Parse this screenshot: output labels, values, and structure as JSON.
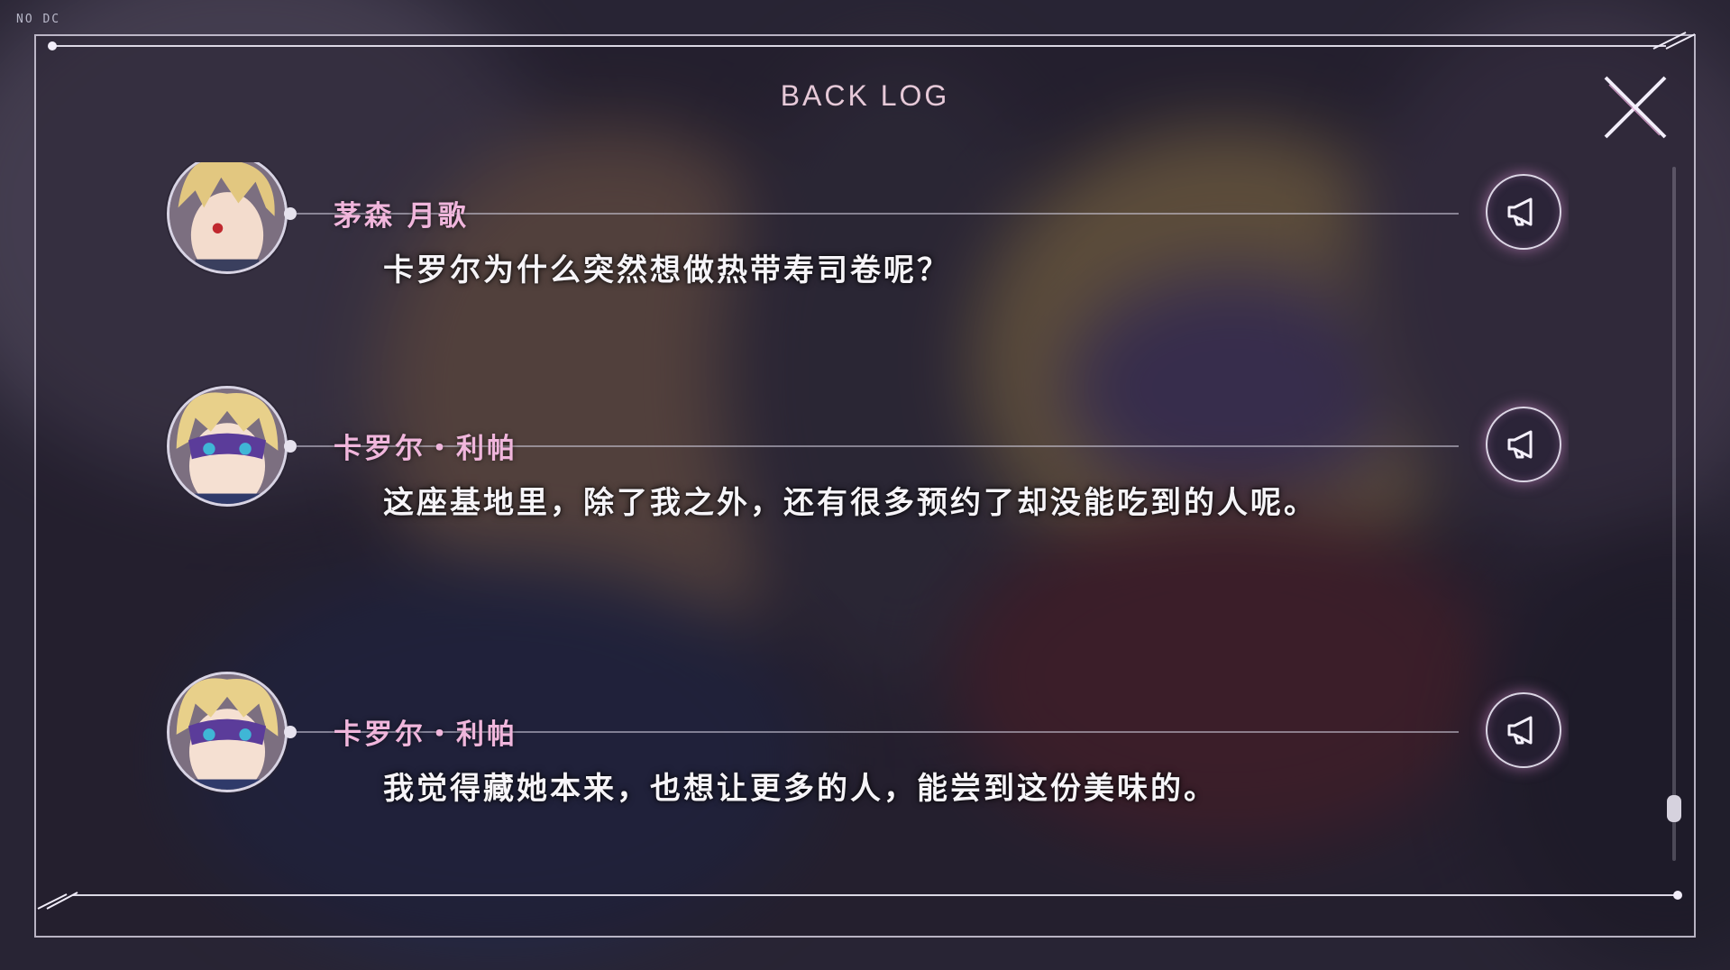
{
  "corner_tag": "NO DC",
  "title": "BACK LOG",
  "icons": {
    "close": "close-x-icon",
    "voice": "megaphone-icon"
  },
  "colors": {
    "name": "#f0b6dc",
    "title": "#e6c9d8",
    "text": "#f6f4f8",
    "frame": "#ebe6f5"
  },
  "entries": [
    {
      "speaker": "茅森 月歌",
      "text": "卡罗尔为什么突然想做热带寿司卷呢？",
      "avatar": "blond-red-eye-avatar"
    },
    {
      "speaker": "卡罗尔・利帕",
      "text": "这座基地里，除了我之外，还有很多预约了却没能吃到的人呢。",
      "avatar": "masked-blonde-avatar"
    },
    {
      "speaker": "卡罗尔・利帕",
      "text": "我觉得藏她本来，也想让更多的人，能尝到这份美味的。",
      "avatar": "masked-blonde-avatar"
    }
  ],
  "scroll_position": 0.95
}
